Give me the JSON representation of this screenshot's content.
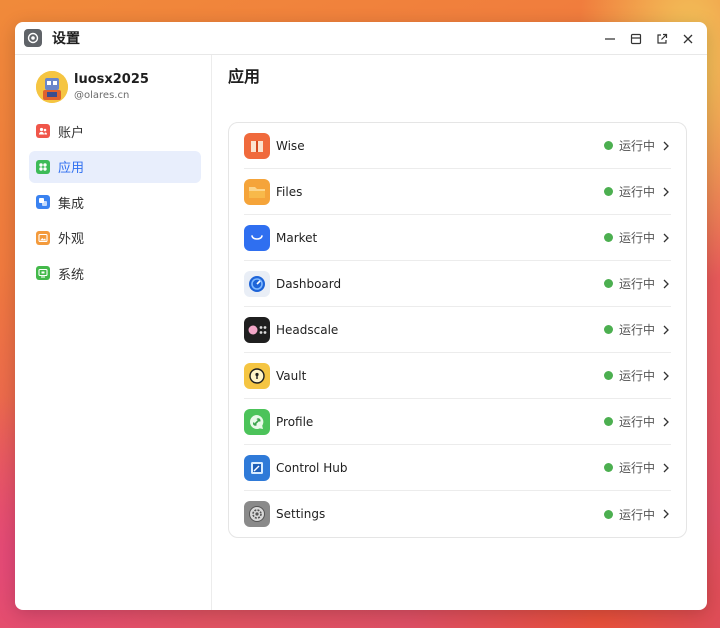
{
  "window": {
    "title": "设置"
  },
  "user": {
    "name": "luosx2025",
    "id": "@olares.cn"
  },
  "sidebar": {
    "items": [
      {
        "label": "账户",
        "icon": "account-icon",
        "color": "#f0564a",
        "active": false
      },
      {
        "label": "应用",
        "icon": "apps-icon",
        "color": "#3dbb57",
        "active": true
      },
      {
        "label": "集成",
        "icon": "integration-icon",
        "color": "#3a82f0",
        "active": false
      },
      {
        "label": "外观",
        "icon": "appearance-icon",
        "color": "#f39a3c",
        "active": false
      },
      {
        "label": "系统",
        "icon": "system-icon",
        "color": "#43b94a",
        "active": false
      }
    ]
  },
  "main": {
    "title": "应用",
    "apps": [
      {
        "name": "Wise",
        "status": "运行中",
        "icon": "wise-icon",
        "color": "#f06a3c"
      },
      {
        "name": "Files",
        "status": "运行中",
        "icon": "files-icon",
        "color": "#f5a43a"
      },
      {
        "name": "Market",
        "status": "运行中",
        "icon": "market-icon",
        "color": "#2f6ff0"
      },
      {
        "name": "Dashboard",
        "status": "运行中",
        "icon": "dashboard-icon",
        "color": "#1e64d8"
      },
      {
        "name": "Headscale",
        "status": "运行中",
        "icon": "headscale-icon",
        "color": "#1f1f1f"
      },
      {
        "name": "Vault",
        "status": "运行中",
        "icon": "vault-icon",
        "color": "#f5c542"
      },
      {
        "name": "Profile",
        "status": "运行中",
        "icon": "profile-icon",
        "color": "#4cc35a"
      },
      {
        "name": "Control Hub",
        "status": "运行中",
        "icon": "control-hub-icon",
        "color": "#2f7ad8"
      },
      {
        "name": "Settings",
        "status": "运行中",
        "icon": "settings-icon",
        "color": "#7a7a7a"
      }
    ]
  }
}
